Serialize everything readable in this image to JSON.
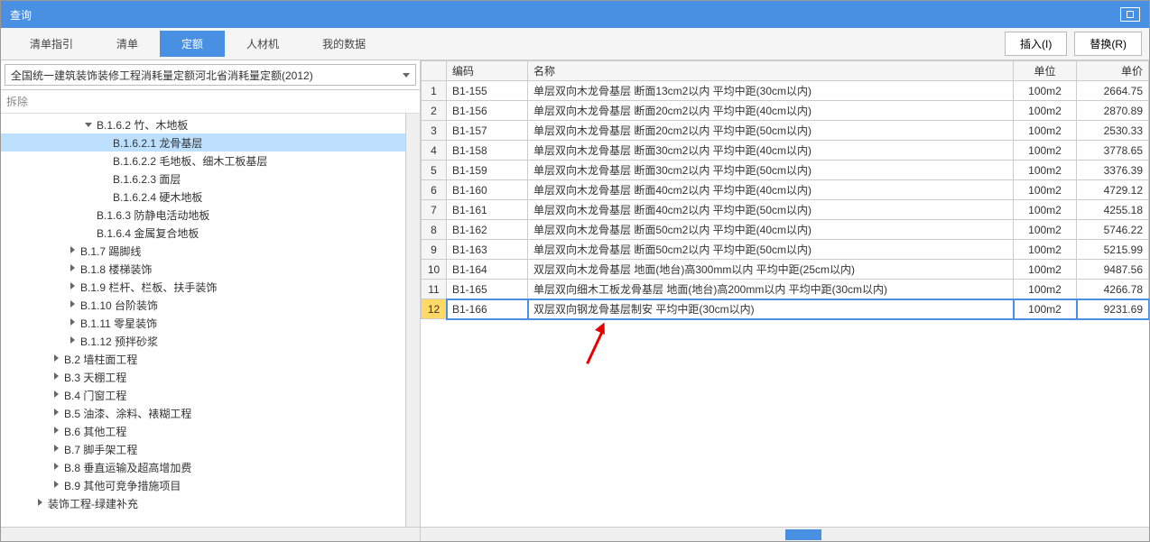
{
  "window": {
    "title": "查询"
  },
  "tabs": [
    {
      "label": "清单指引",
      "active": false
    },
    {
      "label": "清单",
      "active": false
    },
    {
      "label": "定额",
      "active": true
    },
    {
      "label": "人材机",
      "active": false
    },
    {
      "label": "我的数据",
      "active": false
    }
  ],
  "buttons": {
    "insert": "插入(I)",
    "replace": "替换(R)"
  },
  "selector": {
    "value": "全国统一建筑装饰装修工程消耗量定额河北省消耗量定额(2012)"
  },
  "filter": {
    "label": "拆除"
  },
  "tree": [
    {
      "indent": 4,
      "toggle": "down",
      "label": "B.1.6.2 竹、木地板",
      "selected": false
    },
    {
      "indent": 5,
      "toggle": "",
      "label": "B.1.6.2.1 龙骨基层",
      "selected": true
    },
    {
      "indent": 5,
      "toggle": "",
      "label": "B.1.6.2.2 毛地板、细木工板基层",
      "selected": false
    },
    {
      "indent": 5,
      "toggle": "",
      "label": "B.1.6.2.3 面层",
      "selected": false
    },
    {
      "indent": 5,
      "toggle": "",
      "label": "B.1.6.2.4 硬木地板",
      "selected": false
    },
    {
      "indent": 4,
      "toggle": "",
      "label": "B.1.6.3 防静电活动地板",
      "selected": false
    },
    {
      "indent": 4,
      "toggle": "",
      "label": "B.1.6.4 金属复合地板",
      "selected": false
    },
    {
      "indent": 3,
      "toggle": "right",
      "label": "B.1.7 踢脚线",
      "selected": false
    },
    {
      "indent": 3,
      "toggle": "right",
      "label": "B.1.8 楼梯装饰",
      "selected": false
    },
    {
      "indent": 3,
      "toggle": "right",
      "label": "B.1.9 栏杆、栏板、扶手装饰",
      "selected": false
    },
    {
      "indent": 3,
      "toggle": "right",
      "label": "B.1.10 台阶装饰",
      "selected": false
    },
    {
      "indent": 3,
      "toggle": "right",
      "label": "B.1.11 零星装饰",
      "selected": false
    },
    {
      "indent": 3,
      "toggle": "right",
      "label": "B.1.12 预拌砂浆",
      "selected": false
    },
    {
      "indent": 2,
      "toggle": "right",
      "label": "B.2 墙柱面工程",
      "selected": false
    },
    {
      "indent": 2,
      "toggle": "right",
      "label": "B.3 天棚工程",
      "selected": false
    },
    {
      "indent": 2,
      "toggle": "right",
      "label": "B.4 门窗工程",
      "selected": false
    },
    {
      "indent": 2,
      "toggle": "right",
      "label": "B.5 油漆、涂料、裱糊工程",
      "selected": false
    },
    {
      "indent": 2,
      "toggle": "right",
      "label": "B.6 其他工程",
      "selected": false
    },
    {
      "indent": 2,
      "toggle": "right",
      "label": "B.7 脚手架工程",
      "selected": false
    },
    {
      "indent": 2,
      "toggle": "right",
      "label": "B.8 垂直运输及超高增加费",
      "selected": false
    },
    {
      "indent": 2,
      "toggle": "right",
      "label": "B.9 其他可竞争措施项目",
      "selected": false
    },
    {
      "indent": 1,
      "toggle": "right",
      "label": "装饰工程-绿建补充",
      "selected": false
    }
  ],
  "grid": {
    "headers": {
      "row": "",
      "code": "编码",
      "name": "名称",
      "unit": "单位",
      "price": "单价"
    },
    "rows": [
      {
        "n": 1,
        "code": "B1-155",
        "name": "单层双向木龙骨基层 断面13cm2以内 平均中距(30cm以内)",
        "unit": "100m2",
        "price": "2664.75",
        "sel": false
      },
      {
        "n": 2,
        "code": "B1-156",
        "name": "单层双向木龙骨基层 断面20cm2以内 平均中距(40cm以内)",
        "unit": "100m2",
        "price": "2870.89",
        "sel": false
      },
      {
        "n": 3,
        "code": "B1-157",
        "name": "单层双向木龙骨基层 断面20cm2以内 平均中距(50cm以内)",
        "unit": "100m2",
        "price": "2530.33",
        "sel": false
      },
      {
        "n": 4,
        "code": "B1-158",
        "name": "单层双向木龙骨基层 断面30cm2以内 平均中距(40cm以内)",
        "unit": "100m2",
        "price": "3778.65",
        "sel": false
      },
      {
        "n": 5,
        "code": "B1-159",
        "name": "单层双向木龙骨基层 断面30cm2以内 平均中距(50cm以内)",
        "unit": "100m2",
        "price": "3376.39",
        "sel": false
      },
      {
        "n": 6,
        "code": "B1-160",
        "name": "单层双向木龙骨基层 断面40cm2以内 平均中距(40cm以内)",
        "unit": "100m2",
        "price": "4729.12",
        "sel": false
      },
      {
        "n": 7,
        "code": "B1-161",
        "name": "单层双向木龙骨基层 断面40cm2以内 平均中距(50cm以内)",
        "unit": "100m2",
        "price": "4255.18",
        "sel": false
      },
      {
        "n": 8,
        "code": "B1-162",
        "name": "单层双向木龙骨基层 断面50cm2以内 平均中距(40cm以内)",
        "unit": "100m2",
        "price": "5746.22",
        "sel": false
      },
      {
        "n": 9,
        "code": "B1-163",
        "name": "单层双向木龙骨基层 断面50cm2以内 平均中距(50cm以内)",
        "unit": "100m2",
        "price": "5215.99",
        "sel": false
      },
      {
        "n": 10,
        "code": "B1-164",
        "name": "双层双向木龙骨基层 地面(地台)高300mm以内 平均中距(25cm以内)",
        "unit": "100m2",
        "price": "9487.56",
        "sel": false
      },
      {
        "n": 11,
        "code": "B1-165",
        "name": "单层双向细木工板龙骨基层 地面(地台)高200mm以内 平均中距(30cm以内)",
        "unit": "100m2",
        "price": "4266.78",
        "sel": false
      },
      {
        "n": 12,
        "code": "B1-166",
        "name": "双层双向钢龙骨基层制安 平均中距(30cm以内)",
        "unit": "100m2",
        "price": "9231.69",
        "sel": true
      }
    ]
  }
}
